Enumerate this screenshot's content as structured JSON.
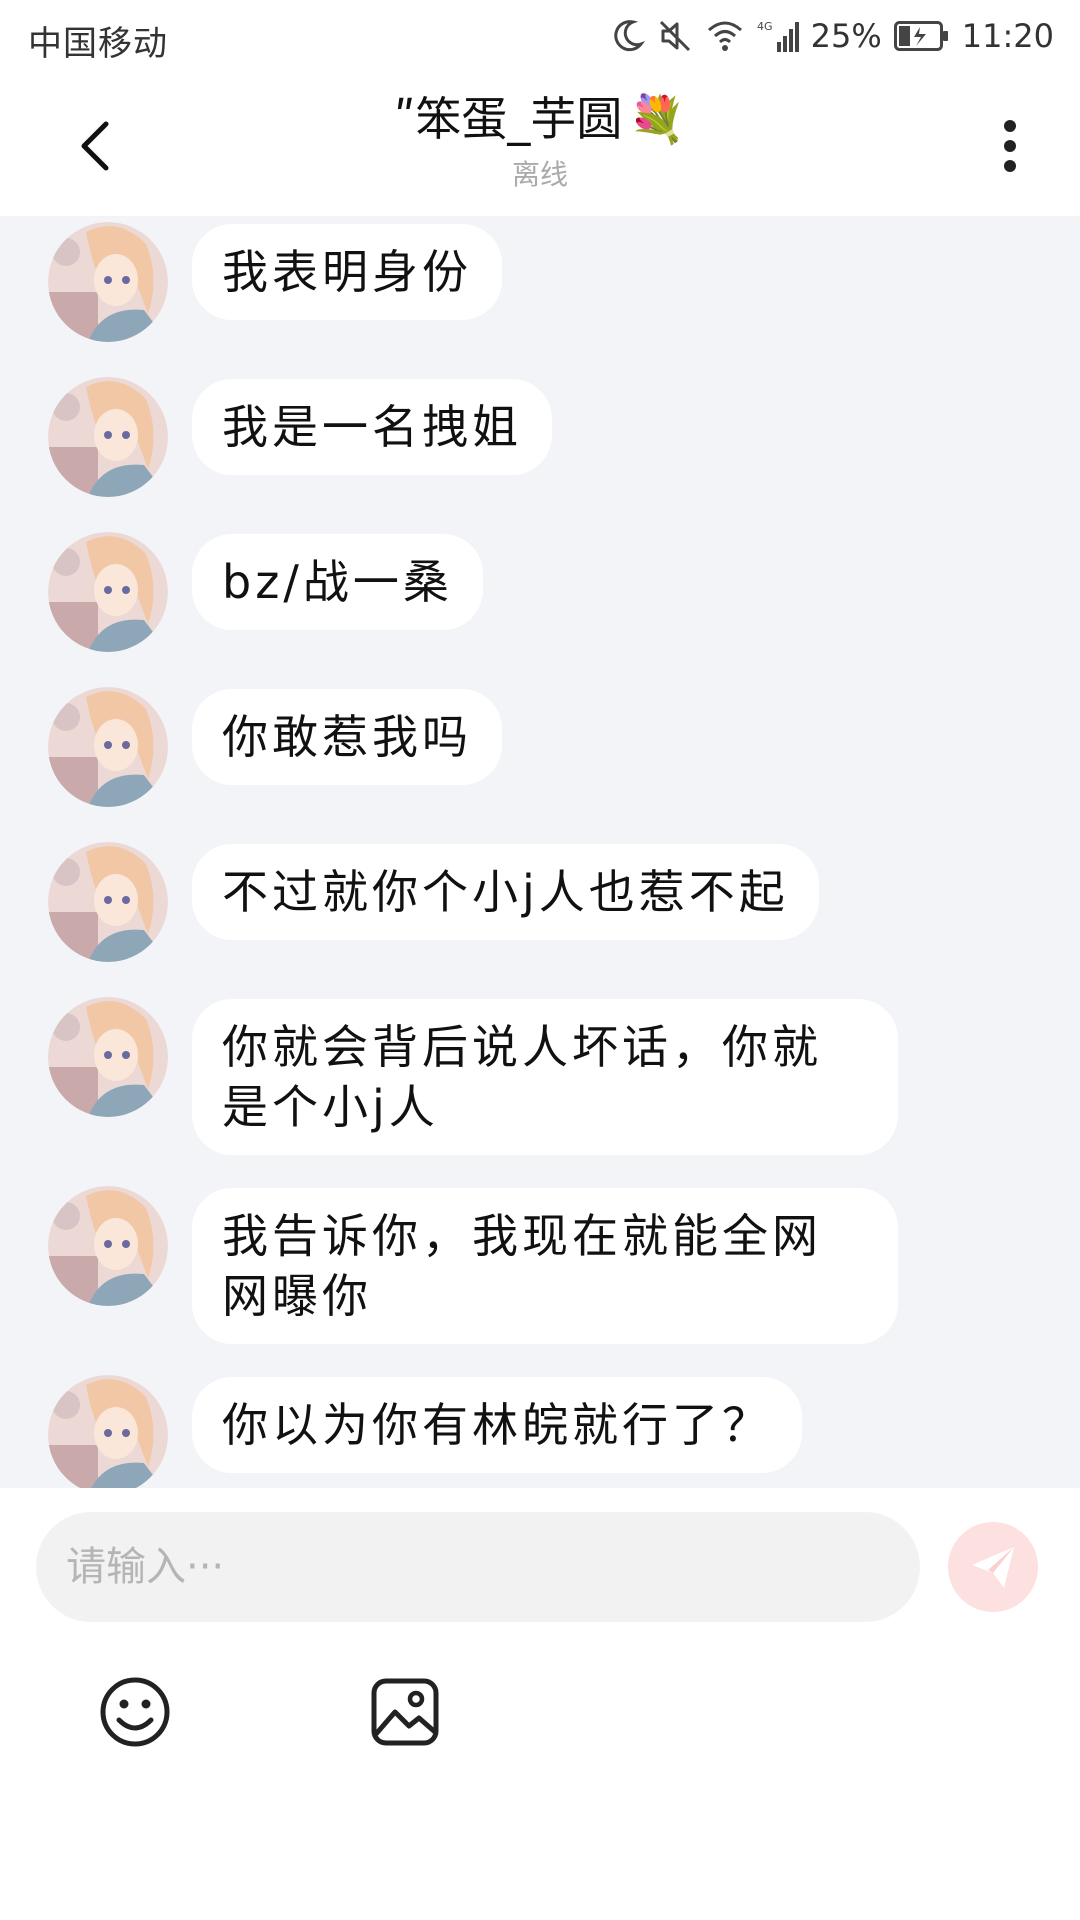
{
  "status_bar": {
    "carrier": "中国移动",
    "network": "4G",
    "battery_percent": "25%",
    "time": "11:20",
    "icons": [
      "moon-icon",
      "mute-icon",
      "wifi-icon",
      "signal-icon",
      "battery-icon"
    ]
  },
  "header": {
    "title": "ʺ笨蛋_芋圆",
    "title_emoji": "💐",
    "subtitle": "离线",
    "back_icon": "chevron-left-icon",
    "more_icon": "more-vertical-icon"
  },
  "messages": [
    {
      "sender": "other",
      "text": "我表明身份"
    },
    {
      "sender": "other",
      "text": "我是一名拽姐"
    },
    {
      "sender": "other",
      "text": "bz/战一桑"
    },
    {
      "sender": "other",
      "text": "你敢惹我吗"
    },
    {
      "sender": "other",
      "text": "不过就你个小j人也惹不起"
    },
    {
      "sender": "other",
      "text": "你就会背后说人坏话，你就是个小j人"
    },
    {
      "sender": "other",
      "text": "我告诉你，我现在就能全网网曝你"
    },
    {
      "sender": "other",
      "text": "你以为你有林皖就行了？"
    }
  ],
  "composer": {
    "placeholder": "请输入···",
    "send_icon": "send-icon",
    "emoji_icon": "smiley-icon",
    "image_icon": "image-icon"
  },
  "colors": {
    "chat_background": "#f3f4f7",
    "bubble": "#ffffff",
    "send_button": "#fde0e0",
    "send_icon": "#ffffff",
    "subtitle": "#aaaaaa"
  }
}
